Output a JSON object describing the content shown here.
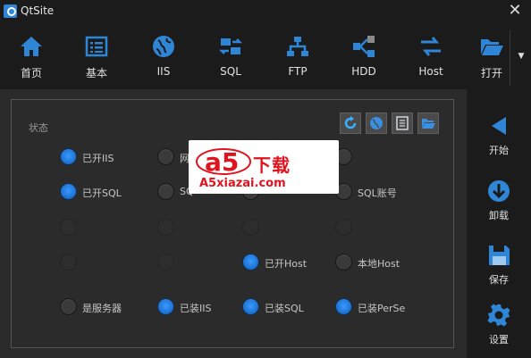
{
  "window": {
    "title": "QtSite",
    "close_icon": "close-icon"
  },
  "toolbar": {
    "items": [
      {
        "label": "首页",
        "icon": "home-icon"
      },
      {
        "label": "基本",
        "icon": "list-icon"
      },
      {
        "label": "IIS",
        "icon": "globe-icon"
      },
      {
        "label": "SQL",
        "icon": "database-icon"
      },
      {
        "label": "FTP",
        "icon": "network-icon"
      },
      {
        "label": "HDD",
        "icon": "disk-icon"
      },
      {
        "label": "Host",
        "icon": "host-icon"
      },
      {
        "label": "打开",
        "icon": "folder-open-icon"
      }
    ],
    "more_icon": "chevron-down-icon"
  },
  "status_panel": {
    "title": "状态",
    "mini_buttons": [
      "refresh-icon",
      "globe-icon",
      "document-icon",
      "folder-icon"
    ],
    "rows": [
      [
        {
          "label": "已开IIS",
          "on": true
        },
        {
          "label": "网",
          "on": false
        },
        {
          "label": "",
          "on": false
        },
        {
          "label": "",
          "on": false
        }
      ],
      [
        {
          "label": "已开SQL",
          "on": true
        },
        {
          "label": "SQ",
          "on": false
        },
        {
          "label": "",
          "on": false
        },
        {
          "label": "SQL账号",
          "on": false
        }
      ],
      [
        {
          "label": "",
          "on": false,
          "dim": true
        },
        {
          "label": "",
          "on": false,
          "dim": true
        },
        {
          "label": "",
          "on": false,
          "dim": true
        },
        {
          "label": "",
          "on": false,
          "dim": true
        }
      ],
      [
        {
          "label": "",
          "on": false,
          "dim": true
        },
        {
          "label": "",
          "on": false,
          "dim": true
        },
        {
          "label": "已开Host",
          "on": true
        },
        {
          "label": "本地Host",
          "on": false
        }
      ],
      [
        {
          "label": "是服务器",
          "on": false
        },
        {
          "label": "已装IIS",
          "on": true
        },
        {
          "label": "已装SQL",
          "on": true
        },
        {
          "label": "已装PerSe",
          "on": true
        }
      ]
    ]
  },
  "watermark": {
    "brand": "下载",
    "url": "A5xiazai.com",
    "logo_text": "a5"
  },
  "side": {
    "items": [
      {
        "label": "开始",
        "icon": "play-icon"
      },
      {
        "label": "卸载",
        "icon": "download-icon"
      },
      {
        "label": "保存",
        "icon": "save-icon"
      },
      {
        "label": "设置",
        "icon": "gear-icon"
      }
    ]
  }
}
